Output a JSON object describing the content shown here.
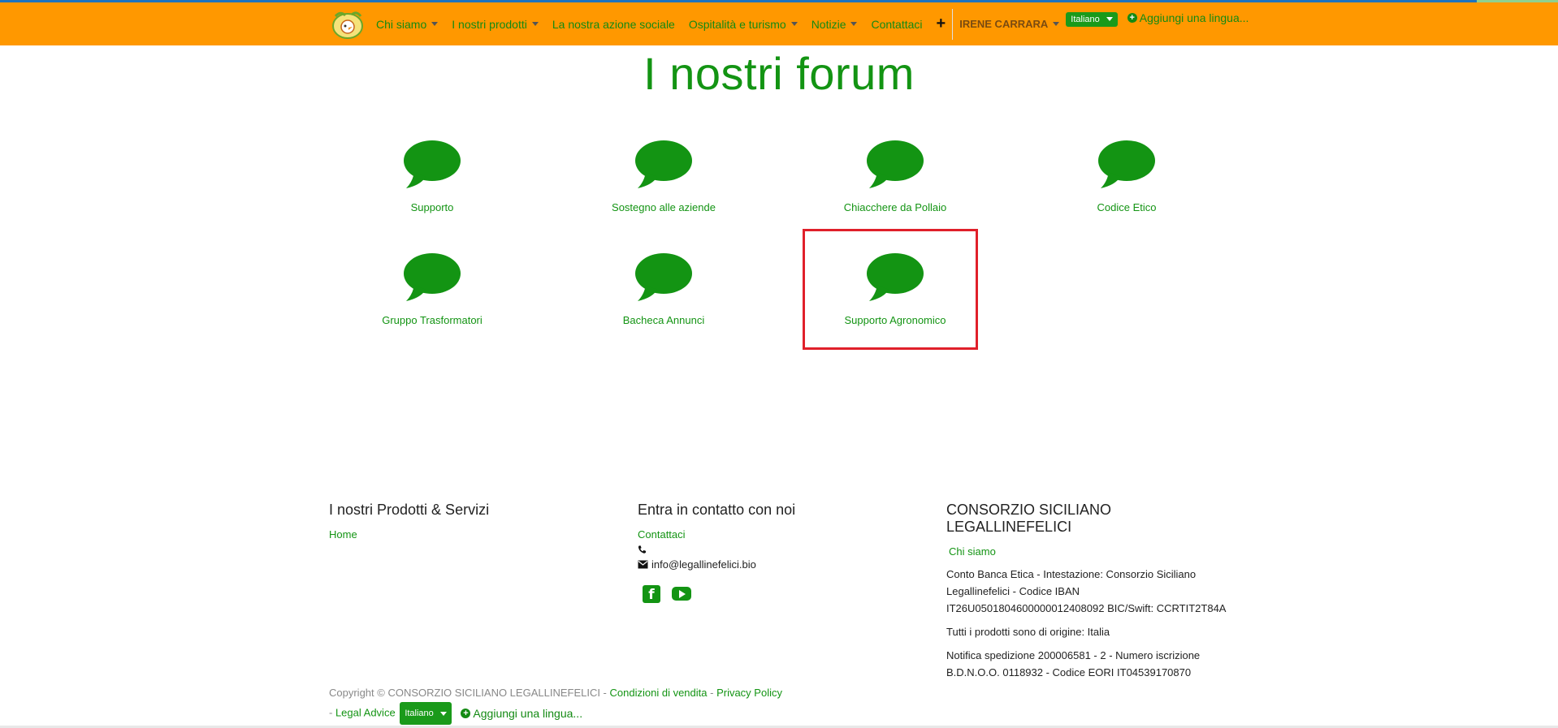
{
  "colors": {
    "navbar": "#ff9800",
    "accent": "#139413",
    "highlight": "#e0202a"
  },
  "nav": {
    "items": [
      {
        "label": "Chi siamo",
        "dropdown": true
      },
      {
        "label": "I nostri prodotti",
        "dropdown": true
      },
      {
        "label": "La nostra azione sociale",
        "dropdown": false
      },
      {
        "label": "Ospitalità e turismo",
        "dropdown": true
      },
      {
        "label": "Notizie",
        "dropdown": true
      },
      {
        "label": "Contattaci",
        "dropdown": false
      }
    ],
    "plus": "+",
    "user": "IRENE CARRARA",
    "language": "Italiano",
    "add_language": "Aggiungi una lingua..."
  },
  "page": {
    "title": "I nostri forum"
  },
  "forums": [
    {
      "label": "Supporto",
      "icon": "speech-bubble-icon"
    },
    {
      "label": "Sostegno alle aziende",
      "icon": "speech-bubble-icon"
    },
    {
      "label": "Chiacchere da Pollaio",
      "icon": "speech-bubble-icon"
    },
    {
      "label": "Codice Etico",
      "icon": "speech-bubble-icon"
    },
    {
      "label": "Gruppo Trasformatori",
      "icon": "speech-bubble-icon"
    },
    {
      "label": "Bacheca Annunci",
      "icon": "speech-bubble-icon"
    },
    {
      "label": "Supporto Agronomico",
      "icon": "speech-bubble-icon"
    }
  ],
  "footer": {
    "col1": {
      "heading": "I nostri Prodotti & Servizi",
      "links": [
        "Home"
      ]
    },
    "col2": {
      "heading": "Entra in contatto con noi",
      "contact_link": "Contattaci",
      "phone": "",
      "email": "info@legallinefelici.bio",
      "social": [
        "facebook-icon",
        "youtube-icon"
      ]
    },
    "col3": {
      "heading": "CONSORZIO SICILIANO LEGALLINEFELICI",
      "link": "Chi siamo",
      "bank": "Conto Banca Etica - Intestazione: Consorzio Siciliano Legallinefelici - Codice IBAN IT26U0501804600000012408092 BIC/Swift: CCRTIT2T84A",
      "origin": "Tutti i prodotti sono di origine: Italia",
      "notice": "Notifica spedizione  200006581 - 2 - Numero iscrizione B.D.N.O.O. 0118932 - Codice EORI IT04539170870"
    },
    "copyright": "Copyright © CONSORZIO SICILIANO LEGALLINEFELICI -",
    "conditions": "Condizioni di vendita",
    "privacy": "Privacy Policy",
    "legal": "Legal Advice",
    "sep1": " - ",
    "sep2": " - ",
    "language": "Italiano",
    "add_language": "Aggiungi una lingua..."
  }
}
